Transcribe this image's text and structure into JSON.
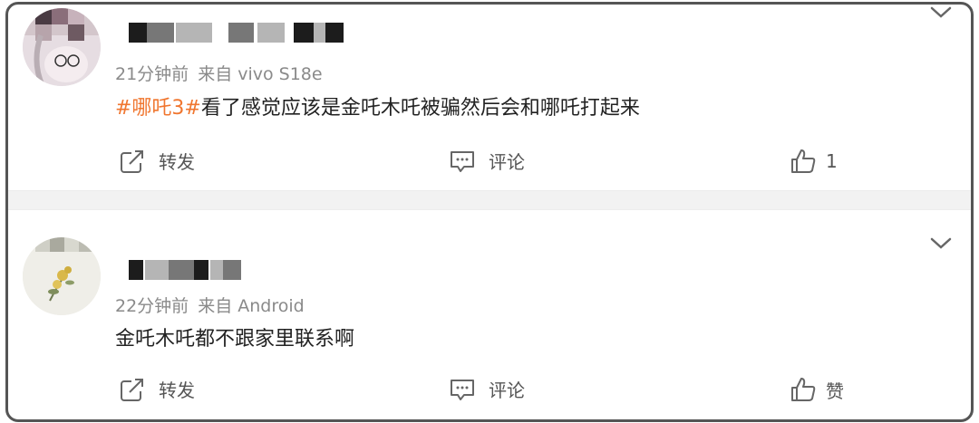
{
  "posts": [
    {
      "time": "21分钟前",
      "source": "来自 vivo S18e",
      "hashtag": "#哪吒3#",
      "text": "看了感觉应该是金吒木吒被骗然后会和哪吒打起来",
      "actions": {
        "forward": "转发",
        "comment": "评论",
        "like": "1"
      }
    },
    {
      "time": "22分钟前",
      "source": "来自 Android",
      "text": "金吒木吒都不跟家里联系啊",
      "actions": {
        "forward": "转发",
        "comment": "评论",
        "like": "赞"
      }
    }
  ],
  "icons": {
    "forward": "forward-icon",
    "comment": "comment-icon",
    "like": "like-icon",
    "menu": "chevron-down-icon"
  },
  "colors": {
    "hashtag": "#f0762f",
    "frame": "#555555",
    "meta": "#8a8a8a"
  }
}
